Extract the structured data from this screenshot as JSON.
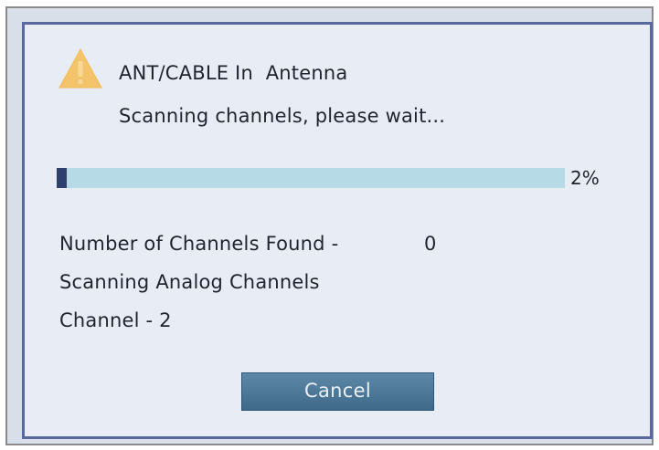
{
  "dialog": {
    "icon": "warning-icon",
    "input_label": "ANT/CABLE In  Antenna",
    "message": "Scanning channels, please wait..."
  },
  "progress": {
    "percent": 2,
    "label": "2%",
    "track_color": "#b6dbe7",
    "fill_color": "#2f3f6e"
  },
  "status": {
    "found_label": "Number of Channels Found -",
    "found_count": "0",
    "scan_type": "Scanning Analog Channels",
    "channel_text": "Channel - 2"
  },
  "buttons": {
    "cancel_label": "Cancel"
  },
  "colors": {
    "panel_border": "#5a68a0",
    "panel_bg": "#e8edf5",
    "warning": "#f3c46a",
    "button": "#4f7a9a"
  }
}
